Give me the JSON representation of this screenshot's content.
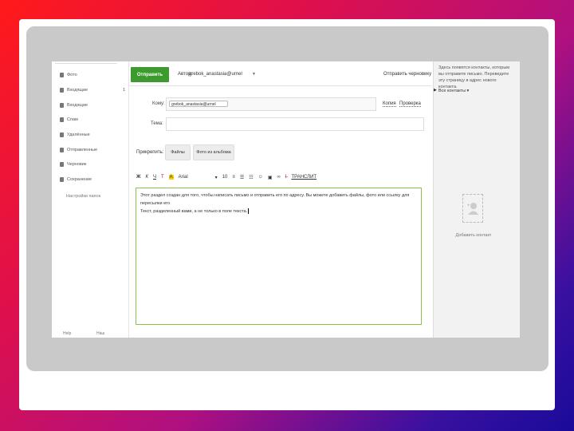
{
  "sidebar": {
    "items": [
      {
        "label": "Фото",
        "count": ""
      },
      {
        "label": "Входящие",
        "count": "1"
      },
      {
        "label": "Входящие",
        "count": ""
      },
      {
        "label": "Спам",
        "count": ""
      },
      {
        "label": "Удалённые",
        "count": ""
      },
      {
        "label": "Отправленные",
        "count": ""
      },
      {
        "label": "Черновик",
        "count": ""
      },
      {
        "label": "Сохранение",
        "count": ""
      }
    ],
    "folders_link": "Настройки папок",
    "footer_left": "Help",
    "footer_right": "Наш"
  },
  "compose": {
    "send_label": "Отправить",
    "from_label": "Автор:",
    "from_value": "grebok_anastasia@urnel",
    "hide_link": "Отправить черновику",
    "to_label": "Кому:",
    "to_chip": "grebok_anastasia@urnel",
    "copy_link": "Копия",
    "bcc_link": "Проверка",
    "subject_label": "Тема:",
    "attach_label": "Прикрепить:",
    "btn_files": "Файлы",
    "btn_photos": "Фото из альбома",
    "font_name": "Arial",
    "font_size": "10",
    "translit": "ТРАНСЛИТ",
    "body_line1": "Этот раздел создан для того, чтобы написать письмо и отправить его по адресу. Вы можете добавить файлы, фото или ссылку для пересылки его",
    "body_line2": "Текст, разделенный вами, а не только в поле текста."
  },
  "right_panel": {
    "text": "Здесь появятся контакты, которым вы отправите письмо. Переведите эту страницу в адрес нового контакта.",
    "contacts": "Все контакты ▾",
    "avatar_label": "Добавить контакт"
  }
}
